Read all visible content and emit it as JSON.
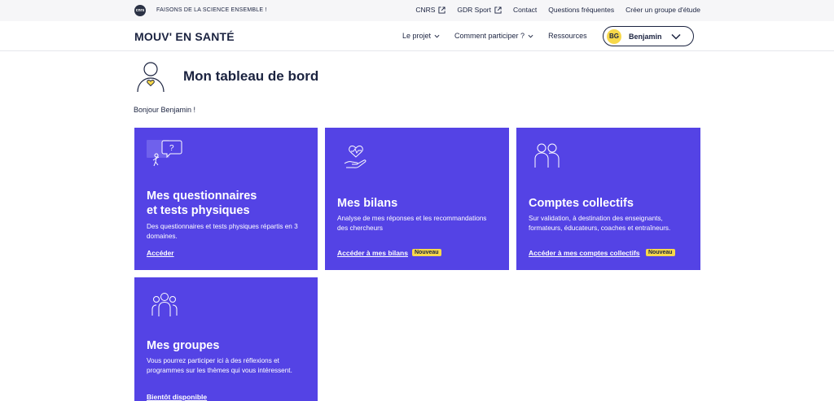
{
  "topbar": {
    "logo_text": "cnrs",
    "tagline": "FAISONS DE LA SCIENCE ENSEMBLE !",
    "links": [
      {
        "label": "CNRS",
        "icon": "external-link-icon"
      },
      {
        "label": "GDR Sport",
        "icon": "external-link-icon"
      },
      {
        "label": "Contact"
      },
      {
        "label": "Questions fréquentes"
      },
      {
        "label": "Créer un groupe d'étude"
      }
    ]
  },
  "navbar": {
    "brand": "MOUV' EN SANTÉ",
    "links": [
      {
        "label": "Le projet",
        "icon": "chevron-down-icon"
      },
      {
        "label": "Comment participer ?",
        "icon": "chevron-down-icon"
      },
      {
        "label": "Ressources"
      }
    ],
    "user": {
      "initials": "BG",
      "name": "Benjamin"
    }
  },
  "page": {
    "title": "Mon tableau de bord",
    "greeting": "Bonjour Benjamin !"
  },
  "cards": [
    {
      "title": "Mes questionnaires et tests physiques",
      "title_line1": "Mes questionnaires",
      "title_line2": "et tests physiques",
      "description": "Des questionnaires et tests physiques répartis en 3 domaines.",
      "link": "Accéder",
      "icon": "questionnaire-icon"
    },
    {
      "title": "Mes bilans",
      "description": "Analyse de mes réponses et les recommandations des chercheurs",
      "link": "Accéder à mes bilans",
      "badge": "Nouveau",
      "icon": "heart-hand-icon"
    },
    {
      "title": "Comptes collectifs",
      "description": "Sur validation, à destination des enseignants, formateurs, éducateurs, coaches et entraîneurs.",
      "link": "Accéder à mes comptes collectifs",
      "badge": "Nouveau",
      "icon": "people-icon"
    },
    {
      "title": "Mes groupes",
      "description": "Vous pourrez participer ici à des réflexions et programmes sur les thèmes qui vous intéressent.",
      "link": "Bientôt disponible",
      "icon": "group-icon"
    }
  ],
  "colors": {
    "card_bg": "#5443e5",
    "badge_bg": "#f7d84a",
    "text_dark": "#1b2340"
  }
}
